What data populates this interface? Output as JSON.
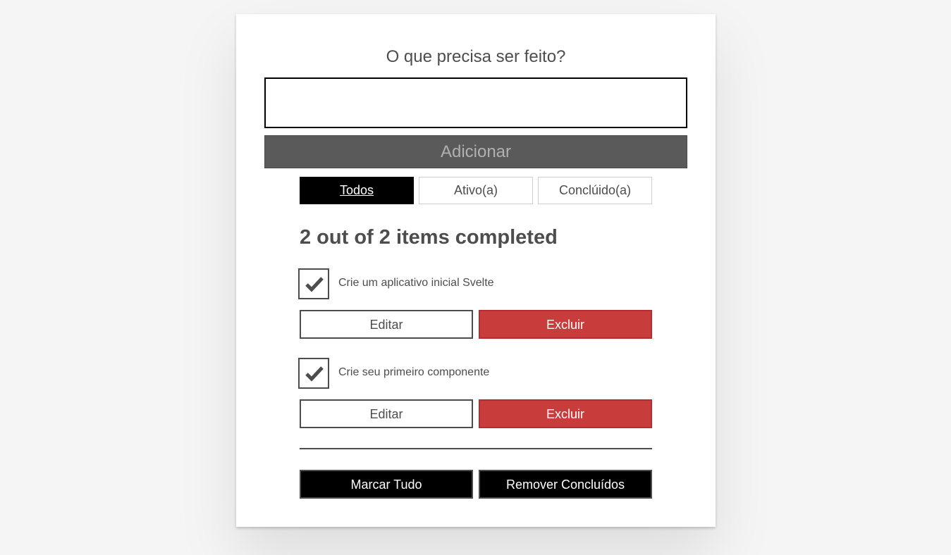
{
  "form": {
    "heading": "O que precisa ser feito?",
    "input_value": "",
    "add_label": "Adicionar"
  },
  "filters": [
    {
      "label": "Todos",
      "active": true
    },
    {
      "label": "Ativo(a)",
      "active": false
    },
    {
      "label": "Conclúido(a)",
      "active": false
    }
  ],
  "status": "2 out of 2 items completed",
  "todos": [
    {
      "label": "Crie um aplicativo inicial Svelte",
      "completed": true,
      "edit_label": "Editar",
      "delete_label": "Excluir"
    },
    {
      "label": "Crie seu primeiro componente",
      "completed": true,
      "edit_label": "Editar",
      "delete_label": "Excluir"
    }
  ],
  "actions": {
    "check_all_label": "Marcar Tudo",
    "remove_completed_label": "Remover Concluídos"
  },
  "colors": {
    "delete_button": "#c83c3c",
    "active_filter": "#000000",
    "add_button": "#5a5a5a"
  }
}
